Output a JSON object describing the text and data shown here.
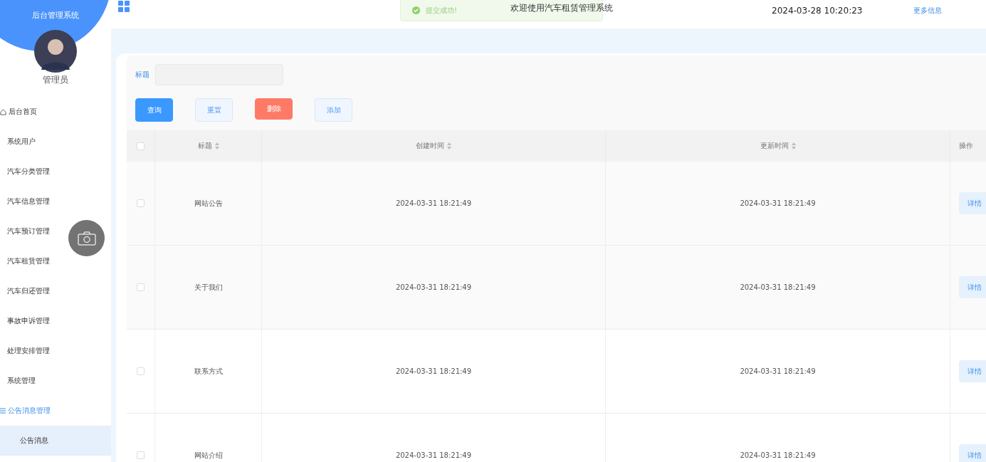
{
  "sidebar": {
    "title": "后台管理系统",
    "user": "管理员",
    "items": [
      {
        "label": "后台首页",
        "kind": "home",
        "selected": false
      },
      {
        "label": "系统用户",
        "kind": "plain",
        "selected": false
      },
      {
        "label": "汽车分类管理",
        "kind": "plain",
        "selected": false
      },
      {
        "label": "汽车信息管理",
        "kind": "plain",
        "selected": false
      },
      {
        "label": "汽车预订管理",
        "kind": "plain",
        "selected": false
      },
      {
        "label": "汽车租赁管理",
        "kind": "plain",
        "selected": false
      },
      {
        "label": "汽车归还管理",
        "kind": "plain",
        "selected": false
      },
      {
        "label": "事故申诉管理",
        "kind": "plain",
        "selected": false
      },
      {
        "label": "处理安排管理",
        "kind": "plain",
        "selected": false
      },
      {
        "label": "系统管理",
        "kind": "plain",
        "selected": false
      },
      {
        "label": "公告消息管理",
        "kind": "group",
        "selected": false,
        "expanded": true,
        "children": [
          {
            "label": "公告消息",
            "selected": true
          }
        ]
      }
    ]
  },
  "header": {
    "welcome": "欢迎使用汽车租赁管理系统",
    "datetime": "2024-03-28 10:20:23",
    "more_link": "更多信息"
  },
  "toast": {
    "message": "提交成功!"
  },
  "search": {
    "label": "标题"
  },
  "buttons": [
    {
      "label": "查询",
      "kind": "primary"
    },
    {
      "label": "重置",
      "kind": "light"
    },
    {
      "label": "删除",
      "kind": "danger"
    },
    {
      "label": "添加",
      "kind": "light"
    }
  ],
  "table": {
    "select_all": {
      "checked": false
    },
    "columns": [
      {
        "label": "标题",
        "sortable": true
      },
      {
        "label": "创建时间",
        "sortable": true
      },
      {
        "label": "更新时间",
        "sortable": true
      },
      {
        "label": "操作",
        "sortable": false
      }
    ],
    "rows": [
      {
        "checked": false,
        "title": "网站公告",
        "created": "2024-03-31 18:21:49",
        "updated": "2024-03-31 18:21:49",
        "action": "详情"
      },
      {
        "checked": false,
        "title": "关于我们",
        "created": "2024-03-31 18:21:49",
        "updated": "2024-03-31 18:21:49",
        "action": "详情"
      },
      {
        "checked": false,
        "title": "联系方式",
        "created": "2024-03-31 18:21:49",
        "updated": "2024-03-31 18:21:49",
        "action": "详情"
      },
      {
        "checked": false,
        "title": "网站介绍",
        "created": "2024-03-31 18:21:49",
        "updated": "2024-03-31 18:21:49",
        "action": "详情"
      }
    ]
  }
}
